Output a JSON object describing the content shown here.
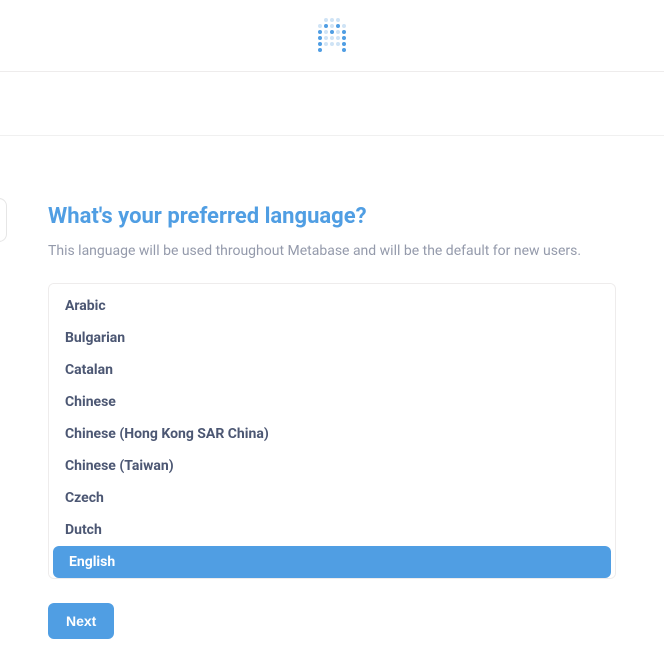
{
  "header": {
    "logo_name": "metabase-logo"
  },
  "main": {
    "title": "What's your preferred language?",
    "subtitle": "This language will be used throughout Metabase and will be the default for new users.",
    "languages": [
      {
        "label": "Arabic",
        "selected": false
      },
      {
        "label": "Bulgarian",
        "selected": false
      },
      {
        "label": "Catalan",
        "selected": false
      },
      {
        "label": "Chinese",
        "selected": false
      },
      {
        "label": "Chinese (Hong Kong SAR China)",
        "selected": false
      },
      {
        "label": "Chinese (Taiwan)",
        "selected": false
      },
      {
        "label": "Czech",
        "selected": false
      },
      {
        "label": "Dutch",
        "selected": false
      },
      {
        "label": "English",
        "selected": true
      }
    ],
    "next_label": "Next"
  },
  "colors": {
    "accent": "#509ee3",
    "text_muted": "#949aab",
    "text_item": "#4c5773",
    "border": "#eeecec"
  }
}
